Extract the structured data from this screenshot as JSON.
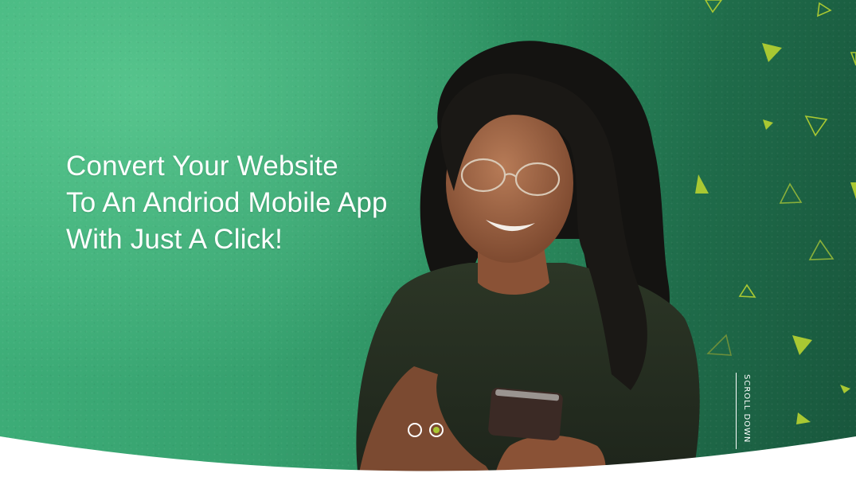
{
  "hero": {
    "headline_lines": [
      "Convert Your Website",
      "To An Andriod Mobile App",
      "With Just A Click!"
    ],
    "scroll_label": "SCROLL DOWN",
    "slider": {
      "dots": [
        "slide-1",
        "slide-2"
      ],
      "active_index": 1
    }
  },
  "colors": {
    "background_green": "#36a06e",
    "accent_lime": "#a9c832",
    "text": "#ffffff"
  },
  "icons": {
    "decorations": "triangle-icon"
  }
}
